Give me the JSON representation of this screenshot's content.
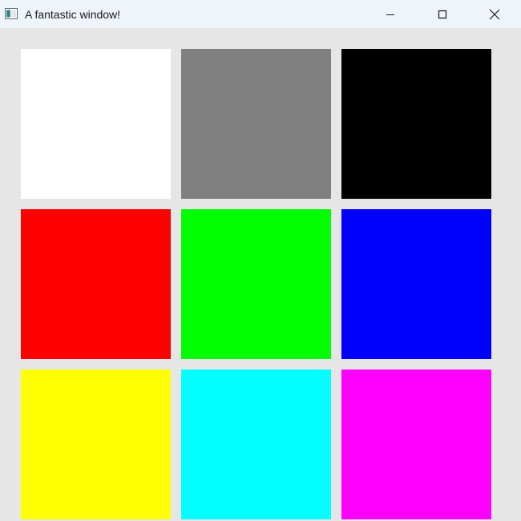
{
  "window": {
    "title": "A fantastic window!",
    "app_icon": "window-app-icon",
    "controls": {
      "minimize_icon": "minimize-icon",
      "maximize_icon": "maximize-icon",
      "close_icon": "close-icon"
    }
  },
  "swatches": [
    {
      "name": "white",
      "color": "#ffffff"
    },
    {
      "name": "gray",
      "color": "#808080"
    },
    {
      "name": "black",
      "color": "#000000"
    },
    {
      "name": "red",
      "color": "#ff0000"
    },
    {
      "name": "green",
      "color": "#00ff00"
    },
    {
      "name": "blue",
      "color": "#0000ff"
    },
    {
      "name": "yellow",
      "color": "#ffff00"
    },
    {
      "name": "cyan",
      "color": "#00ffff"
    },
    {
      "name": "magenta",
      "color": "#ff00ff"
    }
  ],
  "colors": {
    "titlebar_bg": "#eef4f9",
    "client_bg": "#e6e6e6"
  }
}
